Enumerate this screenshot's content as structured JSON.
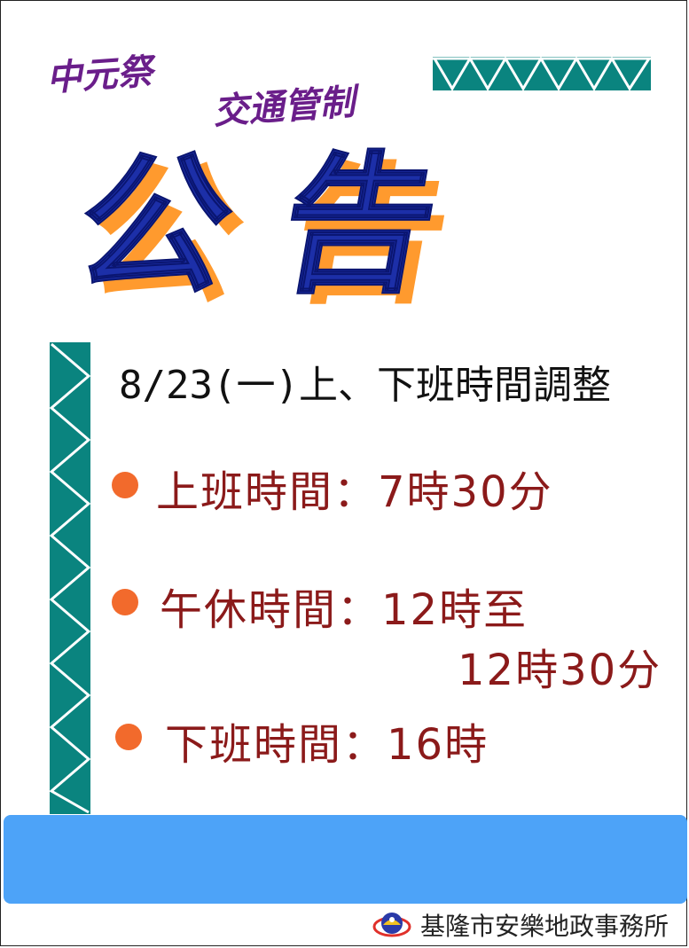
{
  "event": {
    "title": "中元祭",
    "subtitle": "交通管制"
  },
  "headline": "公告",
  "date_line": "8/23(一)上、下班時間調整",
  "items": [
    {
      "label": "上班時間：7時30分"
    },
    {
      "label": "午休時間：12時至",
      "continuation": "12時30分"
    },
    {
      "label": "下班時間：16時"
    }
  ],
  "footer": {
    "organization": "基隆市安樂地政事務所",
    "logo_icon": "land-office-logo-icon"
  },
  "colors": {
    "title_purple": "#6a1e8a",
    "headline_blue": "#1c2fa8",
    "headline_shadow": "#ff9a2e",
    "teal": "#0a847f",
    "bullet_orange": "#f26a2c",
    "item_text": "#8b1a1a",
    "band_blue": "#4da3f8"
  }
}
